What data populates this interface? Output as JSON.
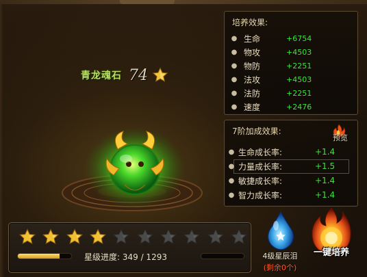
{
  "stone": {
    "name": "青龙魂石",
    "level": "74",
    "star_icon": "gold-star-icon"
  },
  "training": {
    "heading": "培养效果:",
    "stats": [
      {
        "name": "生命",
        "value": "+6754"
      },
      {
        "name": "物攻",
        "value": "+4503"
      },
      {
        "name": "物防",
        "value": "+2251"
      },
      {
        "name": "法攻",
        "value": "+4503"
      },
      {
        "name": "法防",
        "value": "+2251"
      },
      {
        "name": "速度",
        "value": "+2476"
      }
    ]
  },
  "bonus": {
    "heading": "7阶加成效果:",
    "preview_label": "预览",
    "growth": [
      {
        "name": "生命成长率:",
        "value": "+1.4"
      },
      {
        "name": "力量成长率:",
        "value": "+1.5"
      },
      {
        "name": "敏捷成长率:",
        "value": "+1.4"
      },
      {
        "name": "智力成长率:",
        "value": "+1.4"
      }
    ],
    "highlighted_index": 1
  },
  "stars": {
    "total": 10,
    "filled": 4
  },
  "progress": {
    "label": "星级进度: 349 / 1293",
    "current": 349,
    "max": 1293
  },
  "tear_item": {
    "name": "4级星辰泪",
    "count": "(剩余0个)",
    "icon": "star-tear-icon"
  },
  "onekey": {
    "label": "一键培养",
    "icon": "flame-orb-icon"
  },
  "colors": {
    "stat_value": "#3fe23f",
    "highlight_border": "#d01818",
    "star_gold": "#f0c030",
    "stone_name": "#b8e060"
  }
}
